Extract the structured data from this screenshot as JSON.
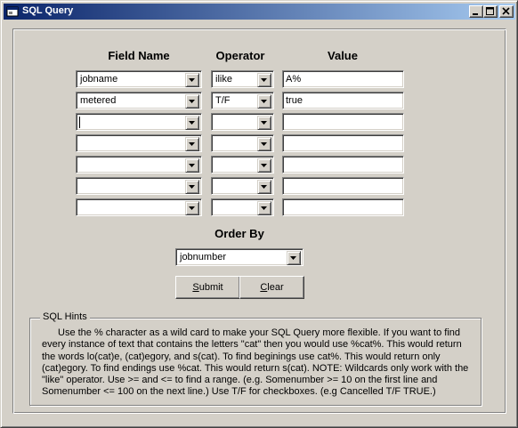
{
  "window": {
    "title": "SQL Query",
    "controls": [
      "minimize-icon",
      "maximize-icon",
      "close-icon"
    ]
  },
  "headers": {
    "field_name": "Field Name",
    "operator": "Operator",
    "value": "Value"
  },
  "rows": [
    {
      "field": "jobname",
      "operator": "ilike",
      "value": "A%"
    },
    {
      "field": "metered",
      "operator": "T/F",
      "value": "true"
    },
    {
      "field": "",
      "operator": "",
      "value": ""
    },
    {
      "field": "",
      "operator": "",
      "value": ""
    },
    {
      "field": "",
      "operator": "",
      "value": ""
    },
    {
      "field": "",
      "operator": "",
      "value": ""
    },
    {
      "field": "",
      "operator": "",
      "value": ""
    }
  ],
  "order_by": {
    "label": "Order By",
    "selected": "jobnumber"
  },
  "buttons": {
    "submit_prefix": "",
    "submit_mnemonic": "S",
    "submit_rest": "ubmit",
    "clear_prefix": "",
    "clear_mnemonic": "C",
    "clear_rest": "lear"
  },
  "hints": {
    "legend": "SQL Hints",
    "text": "Use the % character as a wild card to make your SQL Query more flexible.  If you want to find every instance of text that contains the letters \"cat\" then you would use %cat%.  This would return the words lo(cat)e, (cat)egory, and s(cat).  To find beginings use cat%.  This would return only (cat)egory. To find endings use %cat.  This would return s(cat).  NOTE:  Wildcards only work with the \"like\" operator.  Use >= and <= to find a range.  (e.g. Somenumber >= 10 on the first line and Somenumber <= 100 on the next line.)  Use T/F for checkboxes.  (e.g Cancelled T/F TRUE.)"
  }
}
